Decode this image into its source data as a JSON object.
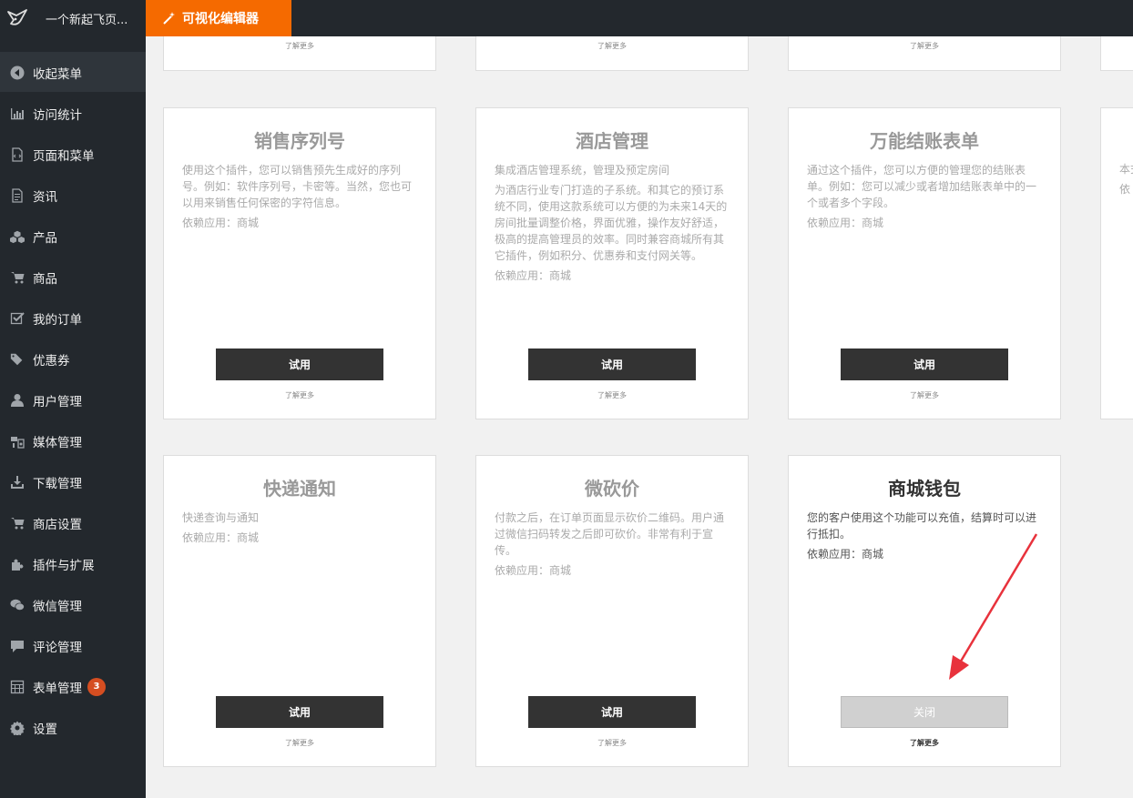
{
  "topbar": {
    "site_name": "一个新起飞页...",
    "editor_label": "可视化编辑器"
  },
  "sidebar": {
    "items": [
      {
        "label": "收起菜单",
        "icon": "collapse-arrow-icon"
      },
      {
        "label": "访问统计",
        "icon": "bar-chart-icon"
      },
      {
        "label": "页面和菜单",
        "icon": "page-icon"
      },
      {
        "label": "资讯",
        "icon": "document-icon"
      },
      {
        "label": "产品",
        "icon": "cubes-icon"
      },
      {
        "label": "商品",
        "icon": "cart-icon"
      },
      {
        "label": "我的订单",
        "icon": "checkbox-icon"
      },
      {
        "label": "优惠券",
        "icon": "tags-icon"
      },
      {
        "label": "用户管理",
        "icon": "user-icon"
      },
      {
        "label": "媒体管理",
        "icon": "media-icon"
      },
      {
        "label": "下载管理",
        "icon": "download-icon"
      },
      {
        "label": "商店设置",
        "icon": "store-cart-icon"
      },
      {
        "label": "插件与扩展",
        "icon": "puzzle-icon"
      },
      {
        "label": "微信管理",
        "icon": "wechat-icon"
      },
      {
        "label": "评论管理",
        "icon": "comment-icon"
      },
      {
        "label": "表单管理",
        "icon": "calculator-icon",
        "badge": "3"
      },
      {
        "label": "设置",
        "icon": "gear-icon"
      }
    ]
  },
  "cards": {
    "more_label": "了解更多",
    "try_label": "试用",
    "close_label": "关闭",
    "row1": [
      {
        "title": "销售序列号",
        "desc": [
          "使用这个插件，您可以销售预先生成好的序列号。例如：软件序列号，卡密等。当然，您也可以用来销售任何保密的字符信息。"
        ],
        "dep": "依赖应用：商城"
      },
      {
        "title": "酒店管理",
        "desc": [
          "集成酒店管理系统，管理及预定房间",
          "为酒店行业专门打造的子系统。和其它的预订系统不同，使用这款系统可以方便的为未来14天的房间批量调整价格，界面优雅，操作友好舒适，极高的提高管理员的效率。同时兼容商城所有其它插件，例如积分、优惠券和支付网关等。"
        ],
        "dep": "依赖应用：商城"
      },
      {
        "title": "万能结账表单",
        "desc": [
          "通过这个插件，您可以方便的管理您的结账表单。例如：您可以减少或者增加结账表单中的一个或者多个字段。"
        ],
        "dep": "依赖应用：商城"
      },
      {
        "desc_fragment": "本式。",
        "dep_fragment": "依"
      }
    ],
    "row2": [
      {
        "title": "快递通知",
        "desc": [
          "快递查询与通知"
        ],
        "dep": "依赖应用：商城"
      },
      {
        "title": "微砍价",
        "desc": [
          "付款之后，在订单页面显示砍价二维码。用户通过微信扫码转发之后即可砍价。非常有利于宣传。"
        ],
        "dep": "依赖应用：商城"
      },
      {
        "title": "商城钱包",
        "desc": [
          "您的客户使用这个功能可以充值，结算时可以进行抵扣。"
        ],
        "dep": "依赖应用：商城"
      }
    ]
  },
  "colors": {
    "accent": "#f56a00",
    "sidebar": "#23282d",
    "badge": "#d54e21",
    "arrow": "#e8323c"
  }
}
